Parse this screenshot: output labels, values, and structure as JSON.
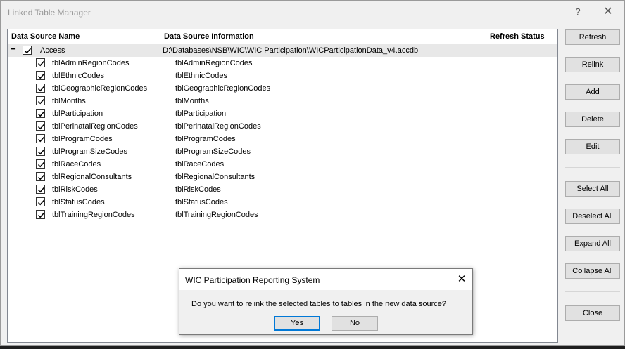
{
  "window": {
    "title": "Linked Table Manager",
    "help_glyph": "?",
    "close_glyph": "✕"
  },
  "columns": {
    "name": "Data Source Name",
    "info": "Data Source Information",
    "status": "Refresh Status"
  },
  "group": {
    "expander": "−",
    "label": "Access",
    "path": "D:\\Databases\\NSB\\WIC\\WIC Participation\\WICParticipationData_v4.accdb",
    "checked": true
  },
  "tables": [
    {
      "name": "tblAdminRegionCodes",
      "info": "tblAdminRegionCodes"
    },
    {
      "name": "tblEthnicCodes",
      "info": "tblEthnicCodes"
    },
    {
      "name": "tblGeographicRegionCodes",
      "info": "tblGeographicRegionCodes"
    },
    {
      "name": "tblMonths",
      "info": "tblMonths"
    },
    {
      "name": "tblParticipation",
      "info": "tblParticipation"
    },
    {
      "name": "tblPerinatalRegionCodes",
      "info": "tblPerinatalRegionCodes"
    },
    {
      "name": "tblProgramCodes",
      "info": "tblProgramCodes"
    },
    {
      "name": "tblProgramSizeCodes",
      "info": "tblProgramSizeCodes"
    },
    {
      "name": "tblRaceCodes",
      "info": "tblRaceCodes"
    },
    {
      "name": "tblRegionalConsultants",
      "info": "tblRegionalConsultants"
    },
    {
      "name": "tblRiskCodes",
      "info": "tblRiskCodes"
    },
    {
      "name": "tblStatusCodes",
      "info": "tblStatusCodes"
    },
    {
      "name": "tblTrainingRegionCodes",
      "info": "tblTrainingRegionCodes"
    }
  ],
  "buttons": {
    "refresh": "Refresh",
    "relink": "Relink",
    "add": "Add",
    "delete": "Delete",
    "edit": "Edit",
    "select_all": "Select All",
    "deselect_all": "Deselect All",
    "expand_all": "Expand All",
    "collapse_all": "Collapse All",
    "close": "Close"
  },
  "dialog": {
    "title": "WIC Participation Reporting System",
    "close_glyph": "✕",
    "message": "Do you want to relink the selected tables to tables in the new data source?",
    "yes": "Yes",
    "no": "No"
  }
}
